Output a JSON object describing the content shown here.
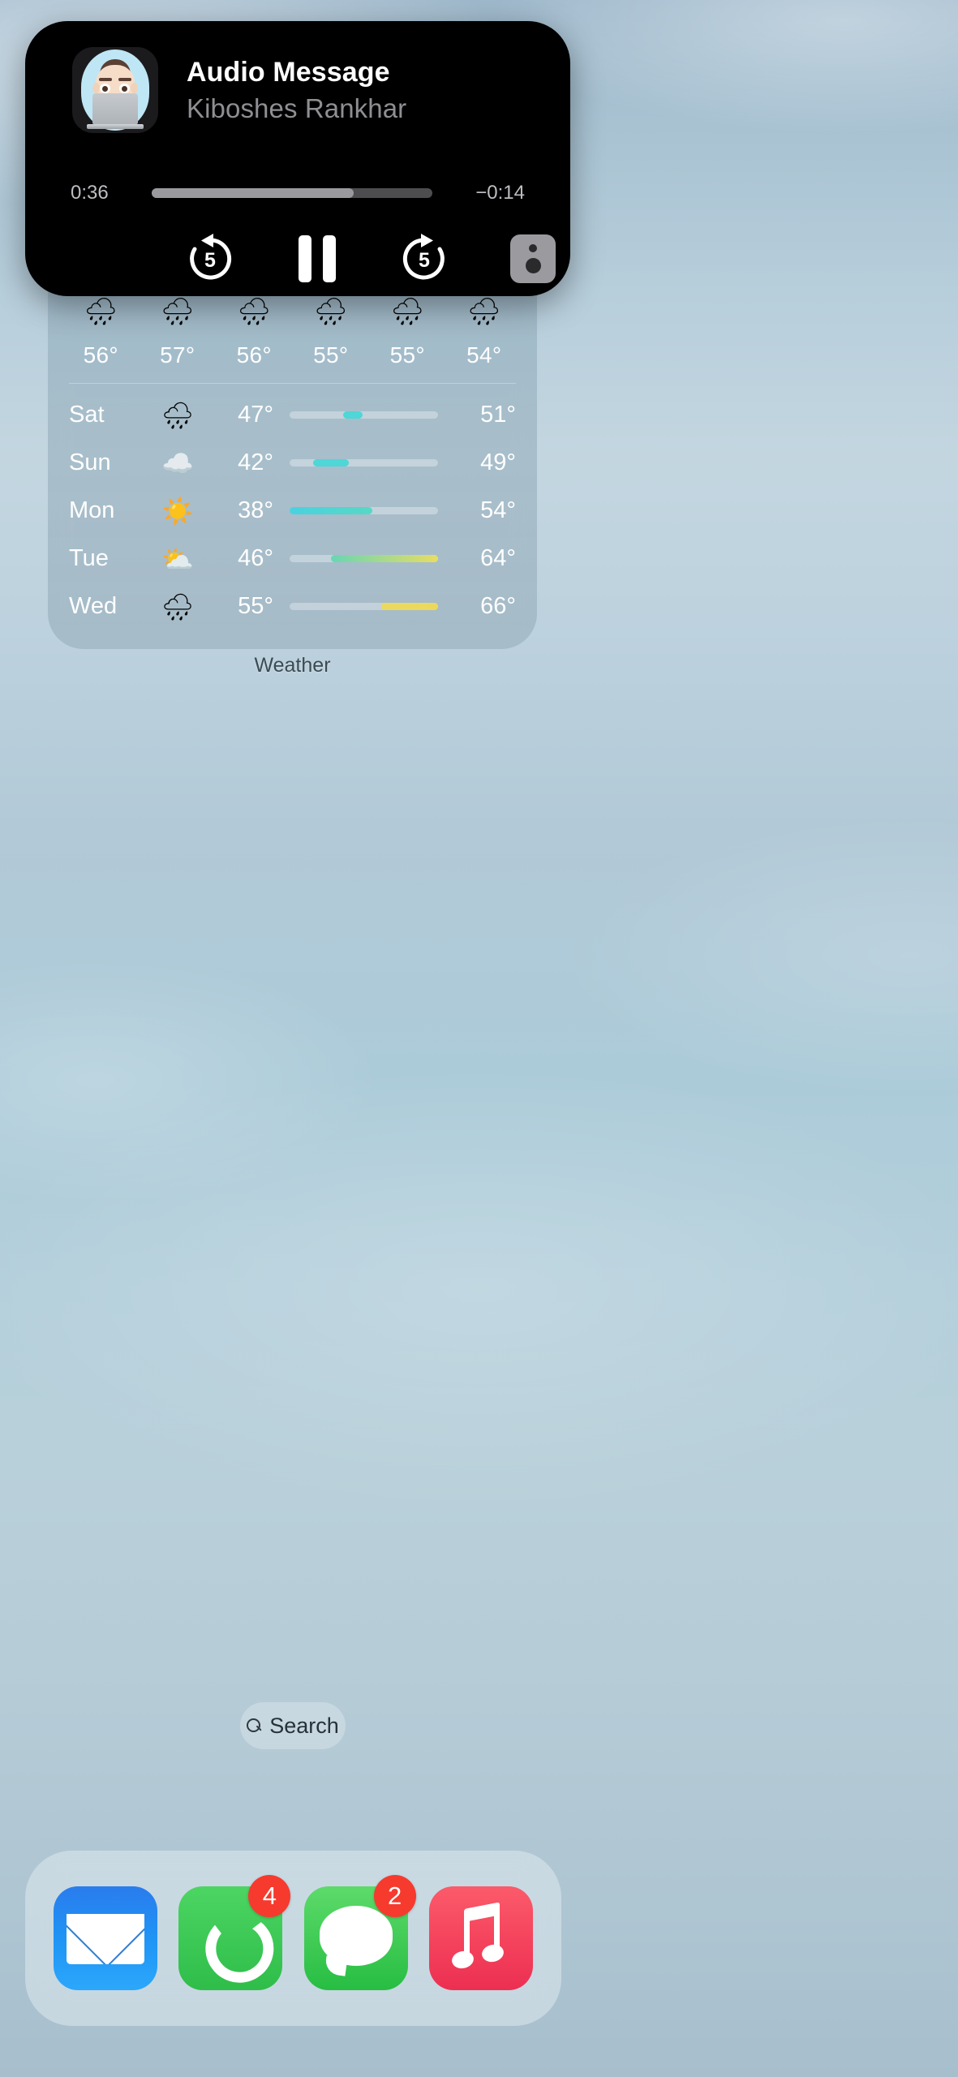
{
  "now_playing": {
    "title": "Audio Message",
    "subtitle": "Kiboshes Rankhar",
    "elapsed": "0:36",
    "remaining": "−0:14",
    "progress_percent": 72,
    "skip_back_label": "5",
    "skip_forward_label": "5",
    "avatar": "memoji-laptop-avatar",
    "controls": {
      "skip_back": "skip-back-5-icon",
      "play_pause": "pause-icon",
      "skip_forward": "skip-forward-5-icon",
      "output_route": "airplay-speaker-icon"
    }
  },
  "weather": {
    "label": "Weather",
    "hourly": [
      {
        "icon": "🌧",
        "temp": "56°"
      },
      {
        "icon": "🌧",
        "temp": "57°"
      },
      {
        "icon": "🌧",
        "temp": "56°"
      },
      {
        "icon": "🌧",
        "temp": "55°"
      },
      {
        "icon": "🌧",
        "temp": "55°"
      },
      {
        "icon": "🌧",
        "temp": "54°"
      }
    ],
    "daily": [
      {
        "day": "Sat",
        "icon": "🌧",
        "low": "47°",
        "high": "51°",
        "bar_start_pct": 36,
        "bar_width_pct": 13,
        "bar_color_from": "#4fd6d6",
        "bar_color_to": "#4fd6d6"
      },
      {
        "day": "Sun",
        "icon": "☁️",
        "low": "42°",
        "high": "49°",
        "bar_start_pct": 16,
        "bar_width_pct": 24,
        "bar_color_from": "#4fd6d6",
        "bar_color_to": "#4fd6d6"
      },
      {
        "day": "Mon",
        "icon": "☀️",
        "low": "38°",
        "high": "54°",
        "bar_start_pct": 0,
        "bar_width_pct": 56,
        "bar_color_from": "#49d2e0",
        "bar_color_to": "#57d8c4"
      },
      {
        "day": "Tue",
        "icon": "⛅",
        "low": "46°",
        "high": "64°",
        "bar_start_pct": 28,
        "bar_width_pct": 72,
        "bar_color_from": "#68d6b4",
        "bar_color_to": "#e8dd62"
      },
      {
        "day": "Wed",
        "icon": "🌧",
        "low": "55°",
        "high": "66°",
        "bar_start_pct": 62,
        "bar_width_pct": 38,
        "bar_color_from": "#ead95f",
        "bar_color_to": "#ecd95c"
      }
    ]
  },
  "search": {
    "label": "Search",
    "icon": "search-icon"
  },
  "dock": {
    "apps": [
      {
        "name": "Mail",
        "badge": ""
      },
      {
        "name": "Phone",
        "badge": "4"
      },
      {
        "name": "Messages",
        "badge": "2"
      },
      {
        "name": "Music",
        "badge": ""
      }
    ]
  }
}
